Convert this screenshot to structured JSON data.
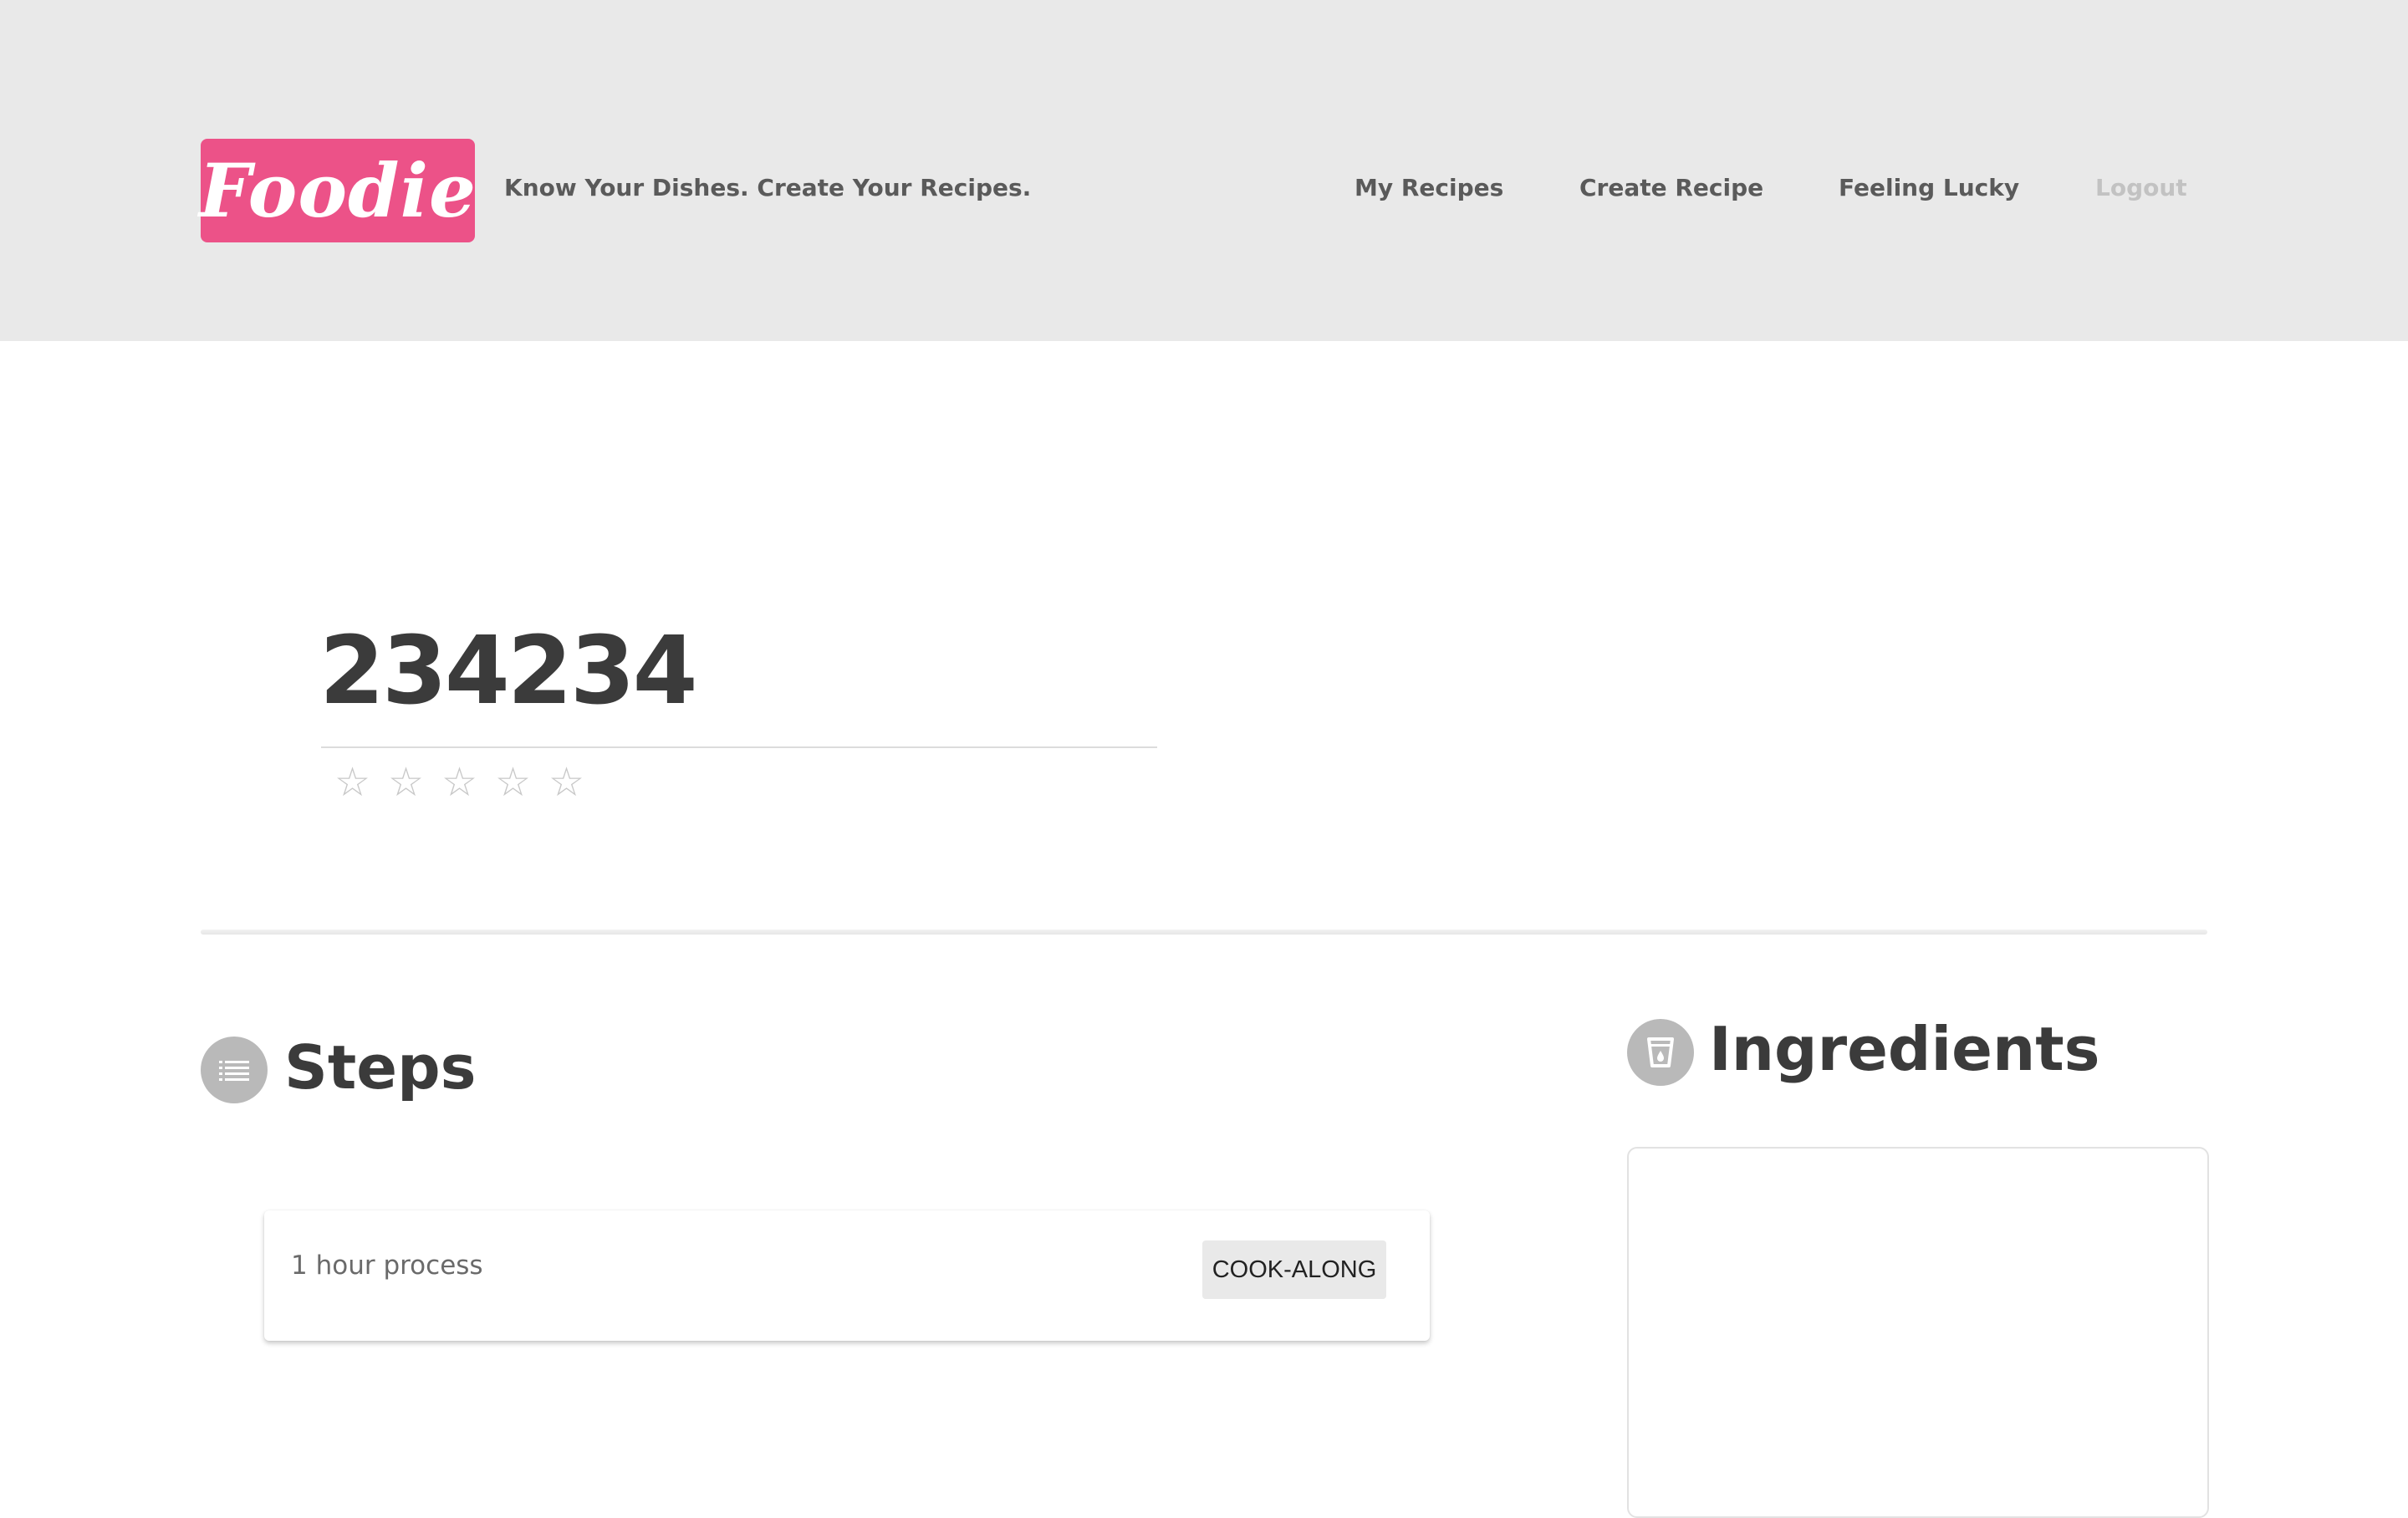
{
  "header": {
    "logo_text": "Foodie",
    "tagline": "Know Your Dishes. Create Your Recipes.",
    "nav": {
      "my_recipes": "My Recipes",
      "create_recipe": "Create Recipe",
      "feeling_lucky": "Feeling Lucky",
      "logout": "Logout"
    }
  },
  "recipe": {
    "title": "234234",
    "rating": {
      "filled": 0,
      "max": 5,
      "star_glyph": "☆"
    }
  },
  "steps": {
    "heading": "Steps",
    "icon": "list-icon",
    "items": [
      {
        "text": "1 hour process",
        "action_label": "COOK-ALONG"
      }
    ]
  },
  "ingredients": {
    "heading": "Ingredients",
    "icon": "cup-icon"
  },
  "colors": {
    "brand": "#ec5288",
    "header_bg": "#e9e9e9",
    "text_dark": "#3b3b3b",
    "icon_circle": "#b9b9b9"
  }
}
